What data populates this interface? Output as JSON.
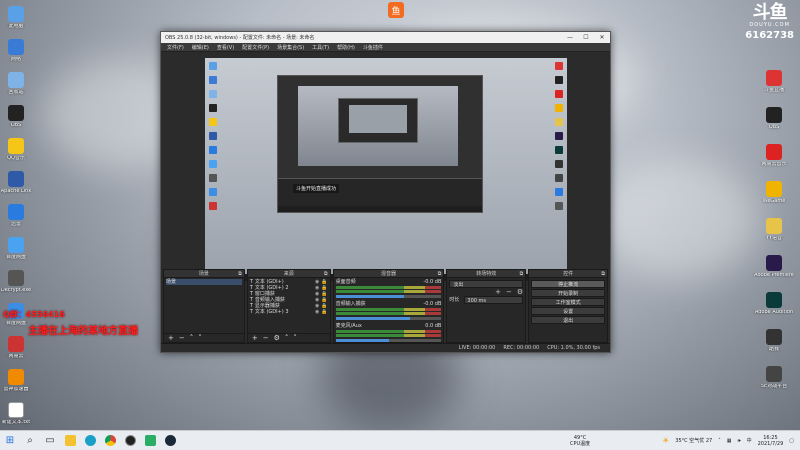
{
  "brand": {
    "logo_text": "斗鱼",
    "site": "DOUYU.COM",
    "room": "6162738"
  },
  "overlay": {
    "line1": "Q群：4556416",
    "line2": "主播在上海的某地方直播"
  },
  "desktop_left": [
    {
      "label": "此电脑",
      "icon": "computer-icon",
      "color": "#5aa0e6"
    },
    {
      "label": "网络",
      "icon": "network-icon",
      "color": "#3a7bd5"
    },
    {
      "label": "回收站",
      "icon": "recycle-bin-icon",
      "color": "#7fb3e8"
    },
    {
      "label": "OBS",
      "icon": "obs-icon",
      "color": "#222"
    },
    {
      "label": "QQ音乐",
      "icon": "music-icon",
      "color": "#f5c518"
    },
    {
      "label": "Apache Link",
      "icon": "link-icon",
      "color": "#2e5aa8"
    },
    {
      "label": "迅雷",
      "icon": "thunder-icon",
      "color": "#2a7be0"
    },
    {
      "label": "百度网盘",
      "icon": "cloud-icon",
      "color": "#4aa3f0"
    },
    {
      "label": "Decrypt.exe",
      "icon": "app-icon",
      "color": "#555"
    },
    {
      "label": "百度网盘",
      "icon": "folder-icon",
      "color": "#3b8ee6"
    },
    {
      "label": "网易云",
      "icon": "app-icon",
      "color": "#c33"
    },
    {
      "label": "雷神加速器",
      "icon": "game-icon",
      "color": "#f08a00"
    },
    {
      "label": "新建文本.txt",
      "icon": "file-icon",
      "color": "#fff"
    }
  ],
  "desktop_right": [
    {
      "label": "斗鱼直播",
      "icon": "app-icon",
      "color": "#d33"
    },
    {
      "label": "OBS",
      "icon": "obs-icon",
      "color": "#222"
    },
    {
      "label": "网易云音乐",
      "icon": "music-icon",
      "color": "#d22"
    },
    {
      "label": "WeGame",
      "icon": "game-icon",
      "color": "#f0b400"
    },
    {
      "label": "YY语音",
      "icon": "app-icon",
      "color": "#e8c34a"
    },
    {
      "label": "Adobe Premiere",
      "icon": "app-icon",
      "color": "#2a1a4a"
    },
    {
      "label": "Adobe Audition",
      "icon": "app-icon",
      "color": "#0a3a3a"
    },
    {
      "label": "酷我",
      "icon": "music-icon",
      "color": "#333"
    },
    {
      "label": "5E对战平台",
      "icon": "game-icon",
      "color": "#444"
    }
  ],
  "top_center_icon": {
    "label": "斗鱼",
    "icon": "douyu-icon"
  },
  "obs": {
    "title": "OBS 25.0.8 (32-bit, windows) - 配置文件: 未命名 - 场景: 未命名",
    "menu": [
      "文件(F)",
      "编辑(E)",
      "查看(V)",
      "配置文件(P)",
      "场景集合(S)",
      "工具(T)",
      "帮助(H)",
      "斗鱼插件"
    ],
    "preview_message": "斗鱼开始直播成功",
    "docks": {
      "scenes": {
        "title": "场景",
        "items": [
          "场景"
        ]
      },
      "sources": {
        "title": "来源",
        "items": [
          "文本 (GDI+)",
          "文本 (GDI+) 2",
          "窗口捕获",
          "音频输入捕获",
          "显示器捕获",
          "文本 (GDI+) 3"
        ]
      },
      "mixer": {
        "title": "混音器",
        "channels": [
          {
            "name": "桌面音频",
            "db": "-0.0 dB",
            "level": 0.65
          },
          {
            "name": "音频输入捕获",
            "db": "-0.0 dB",
            "level": 0.7
          },
          {
            "name": "麦克风/Aux",
            "db": "0.0 dB",
            "level": 0.5
          }
        ]
      },
      "transitions": {
        "title": "转场特效",
        "selected": "淡出",
        "duration_label": "时长",
        "duration": "300 ms"
      },
      "controls": {
        "title": "控件",
        "buttons": [
          "停止推流",
          "开始录制",
          "工作室模式",
          "设置",
          "退出"
        ]
      }
    },
    "status": {
      "live": "LIVE: 00:00:00",
      "rec": "REC: 00:00:00",
      "cpu": "CPU: 1.0%, 30.00 fps"
    }
  },
  "taskbar": {
    "weather_temp": "35°C 空气优 27",
    "cpu_temp": "49°C",
    "cpu_label": "CPU温度",
    "time": "16:25",
    "date": "2021/7/29",
    "lang": "中"
  }
}
